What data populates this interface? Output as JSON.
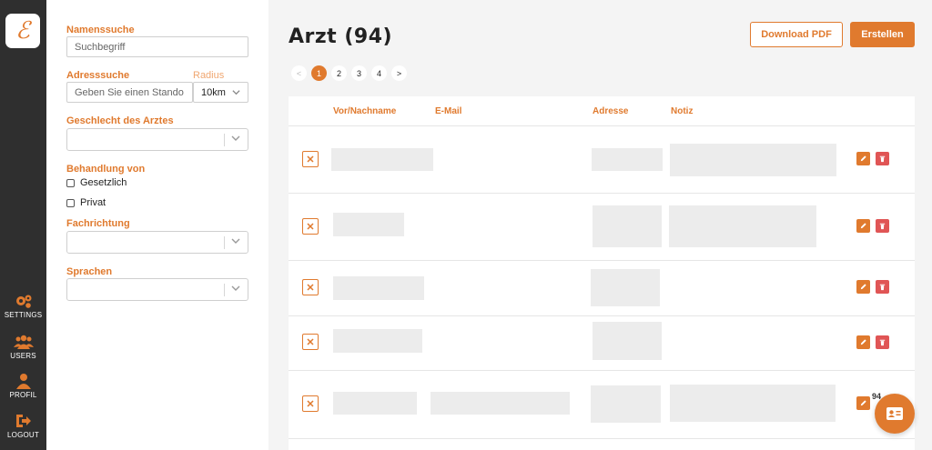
{
  "brand": {
    "logo_glyph": "ℰ",
    "accent": "#e07a2e",
    "danger": "#e05555"
  },
  "sidebar": {
    "items": [
      {
        "label": "SETTINGS",
        "icon": "gears-icon"
      },
      {
        "label": "USERS",
        "icon": "users-icon"
      },
      {
        "label": "PROFIL",
        "icon": "user-icon"
      },
      {
        "label": "LOGOUT",
        "icon": "logout-icon"
      }
    ]
  },
  "filters": {
    "name_label": "Namenssuche",
    "name_placeholder": "Suchbegriff",
    "address_label": "Adresssuche",
    "radius_label": "Radius",
    "address_placeholder": "Geben Sie einen Stando",
    "radius_value": "10km",
    "gender_label": "Geschlecht des Arztes",
    "treatment_label": "Behandlung von",
    "treatment_options": [
      "Gesetzlich",
      "Privat"
    ],
    "specialty_label": "Fachrichtung",
    "languages_label": "Sprachen"
  },
  "main": {
    "title": "Arzt (94)",
    "download_label": "Download PDF",
    "create_label": "Erstellen",
    "pagination": {
      "prev": "<",
      "pages": [
        "1",
        "2",
        "3",
        "4"
      ],
      "next": ">",
      "current": "1"
    },
    "columns": [
      "Vor/Nachname",
      "E-Mail",
      "Adresse",
      "Notiz"
    ],
    "row_delete_glyph": "✕",
    "row_count_visible": 5
  },
  "fab": {
    "badge": "94",
    "icon": "contact-card-icon"
  }
}
